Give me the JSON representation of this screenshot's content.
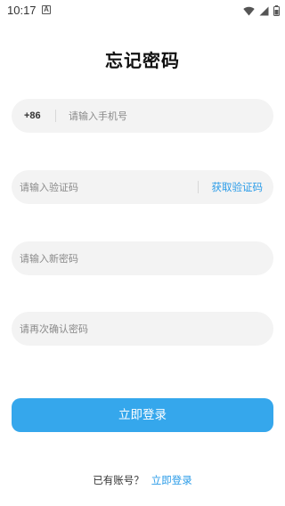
{
  "status_bar": {
    "time": "10:17",
    "notification_icon": "a-icon",
    "icons": [
      "wifi-icon",
      "signal-icon",
      "battery-icon"
    ]
  },
  "title": "忘记密码",
  "phone": {
    "country_code": "+86",
    "placeholder": "请输入手机号",
    "value": ""
  },
  "verification": {
    "placeholder": "请输入验证码",
    "value": "",
    "get_code_label": "获取验证码"
  },
  "new_password": {
    "placeholder": "请输入新密码",
    "value": ""
  },
  "confirm_password": {
    "placeholder": "请再次确认密码",
    "value": ""
  },
  "submit_label": "立即登录",
  "footer": {
    "question": "已有账号？",
    "login_link": "立即登录"
  },
  "colors": {
    "accent": "#35a7ec",
    "link": "#2b9ce8",
    "field_bg": "#f3f3f3"
  }
}
